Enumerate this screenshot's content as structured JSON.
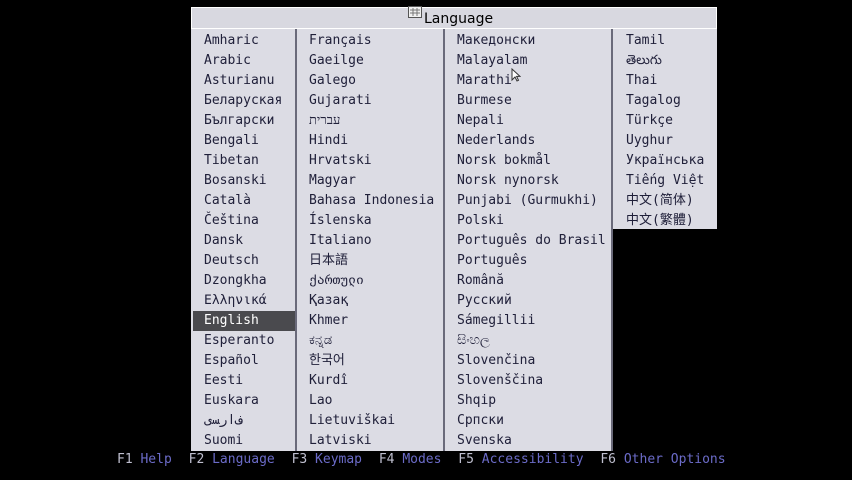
{
  "dialog": {
    "title": "Language",
    "columns": [
      [
        "Amharic",
        "Arabic",
        "Asturianu",
        "Беларуская",
        "Български",
        "Bengali",
        "Tibetan",
        "Bosanski",
        "Català",
        "Čeština",
        "Dansk",
        "Deutsch",
        "Dzongkha",
        "Ελληνικά",
        "English",
        "Esperanto",
        "Español",
        "Eesti",
        "Euskara",
        "ﻑﺍﺭﺴﻯ",
        "Suomi"
      ],
      [
        "Français",
        "Gaeilge",
        "Galego",
        "Gujarati",
        "עברית",
        "Hindi",
        "Hrvatski",
        "Magyar",
        "Bahasa Indonesia",
        "Íslenska",
        "Italiano",
        "日本語",
        "ქართული",
        "Қазақ",
        "Khmer",
        "ಕನ್ನಡ",
        "한국어",
        "Kurdî",
        "Lao",
        "Lietuviškai",
        "Latviski"
      ],
      [
        "Македонски",
        "Malayalam",
        "Marathi",
        "Burmese",
        "Nepali",
        "Nederlands",
        "Norsk bokmål",
        "Norsk nynorsk",
        "Punjabi (Gurmukhi)",
        "Polski",
        "Português do Brasil",
        "Português",
        "Română",
        "Русский",
        "Sámegillii",
        "සිංහල",
        "Slovenčina",
        "Slovenščina",
        "Shqip",
        "Српски",
        "Svenska"
      ],
      [
        "Tamil",
        "తెలుగు",
        "Thai",
        "Tagalog",
        "Türkçe",
        "Uyghur",
        "Українська",
        "Tiếng Việt",
        "中文(简体)",
        "中文(繁體)"
      ]
    ],
    "selected": "English"
  },
  "function_keys": [
    {
      "key": "F1",
      "label": "Help"
    },
    {
      "key": "F2",
      "label": "Language"
    },
    {
      "key": "F3",
      "label": "Keymap"
    },
    {
      "key": "F4",
      "label": "Modes"
    },
    {
      "key": "F5",
      "label": "Accessibility"
    },
    {
      "key": "F6",
      "label": "Other Options"
    }
  ],
  "colors": {
    "background": "#000000",
    "panel": "#dcdce4",
    "selected_bg": "#4a4a4e",
    "fkey_label": "#6b6bc8"
  }
}
